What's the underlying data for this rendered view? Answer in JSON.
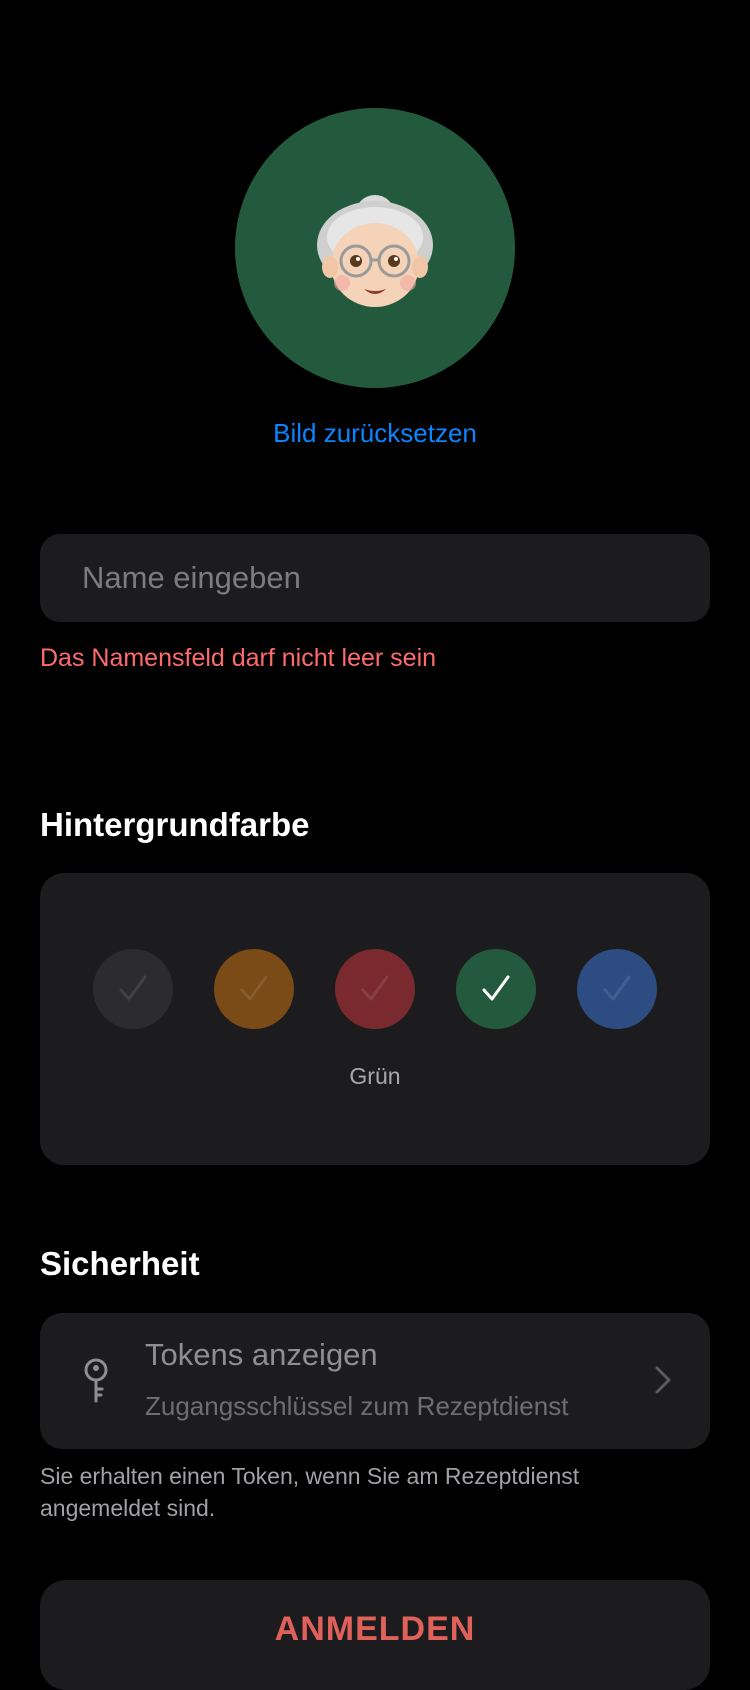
{
  "avatar": {
    "background_color": "#235a3d",
    "icon": "grandmother-memoji-icon",
    "reset_label": "Bild zurücksetzen"
  },
  "name_field": {
    "value": "",
    "placeholder": "Name eingeben",
    "error": "Das Namensfeld darf nicht leer sein"
  },
  "background_color_section": {
    "title": "Hintergrundfarbe",
    "swatches": [
      {
        "id": "grey",
        "color": "#2c2c2e",
        "selected": false
      },
      {
        "id": "orange",
        "color": "#7a4a17",
        "selected": false
      },
      {
        "id": "red",
        "color": "#7a2a2e",
        "selected": false
      },
      {
        "id": "green",
        "color": "#235a3d",
        "selected": true
      },
      {
        "id": "blue",
        "color": "#2d4d82",
        "selected": false
      }
    ],
    "selected_label": "Grün"
  },
  "security_section": {
    "title": "Sicherheit",
    "token_row": {
      "icon": "key-icon",
      "title": "Tokens anzeigen",
      "subtitle": "Zugangsschlüssel zum Rezeptdienst",
      "chevron": "chevron-right-icon"
    },
    "footnote": "Sie erhalten einen Token, wenn Sie am Rezeptdienst angemeldet sind."
  },
  "login_button": {
    "label": "ANMELDEN"
  }
}
